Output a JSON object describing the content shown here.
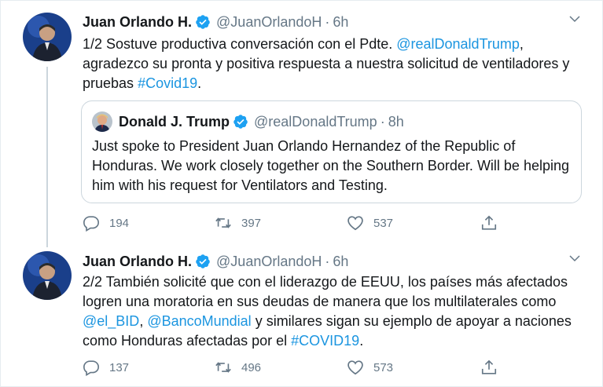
{
  "tweets": [
    {
      "author": {
        "name": "Juan Orlando H.",
        "handle": "@JuanOrlandoH",
        "time": "6h"
      },
      "text": {
        "part1": "1/2 Sostuve productiva conversación con el Pdte. ",
        "mention": "@realDonaldTrump",
        "part2": ", agradezco su pronta y positiva respuesta a nuestra solicitud de ventiladores y pruebas ",
        "hashtag": "#Covid19",
        "part3": "."
      },
      "quote": {
        "author": {
          "name": "Donald J. Trump",
          "handle": "@realDonaldTrump",
          "time": "8h"
        },
        "text": "Just spoke to President Juan Orlando Hernandez of the Republic of Honduras. We work closely together on the Southern Border. Will be helping him with his request for Ventilators and Testing."
      },
      "stats": {
        "replies": "194",
        "retweets": "397",
        "likes": "537"
      }
    },
    {
      "author": {
        "name": "Juan Orlando H.",
        "handle": "@JuanOrlandoH",
        "time": "6h"
      },
      "text": {
        "part1": "2/2 También solicité que con el liderazgo de EEUU, los países más afectados logren una moratoria en sus deudas de manera que los multilaterales como ",
        "mention1": "@el_BID",
        "sep": ", ",
        "mention2": "@BancoMundial",
        "part2": " y similares sigan su ejemplo de apoyar a naciones como Honduras afectadas por el ",
        "hashtag": "#COVID19",
        "part3": "."
      },
      "stats": {
        "replies": "137",
        "retweets": "496",
        "likes": "573"
      }
    }
  ],
  "separator": "·",
  "colors": {
    "link": "#1b95e0",
    "muted": "#657786",
    "verified": "#1da1f2",
    "border": "#ccd6dd"
  },
  "icons": [
    "verified-badge-icon",
    "caret-down-icon",
    "reply-icon",
    "retweet-icon",
    "like-icon",
    "share-icon"
  ]
}
